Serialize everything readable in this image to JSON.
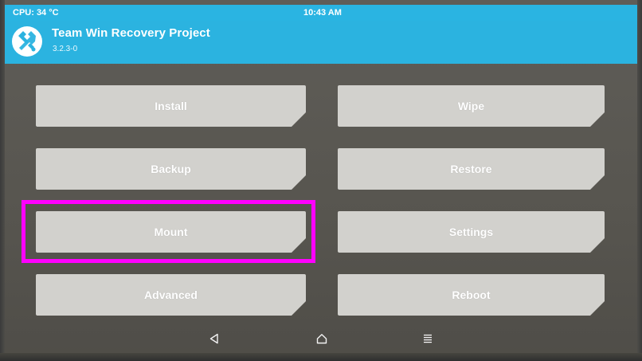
{
  "status_bar": {
    "cpu": "CPU: 34 °C",
    "time": "10:43 AM"
  },
  "header": {
    "title": "Team Win Recovery Project",
    "version": "3.2.3-0",
    "logo_icon": "twrp-logo-icon"
  },
  "buttons": {
    "install": "Install",
    "wipe": "Wipe",
    "backup": "Backup",
    "restore": "Restore",
    "mount": "Mount",
    "settings": "Settings",
    "advanced": "Advanced",
    "reboot": "Reboot"
  },
  "nav": {
    "back_icon": "back-triangle-icon",
    "home_icon": "home-icon",
    "menu_icon": "menu-lines-icon"
  },
  "colors": {
    "accent": "#2bb3e0",
    "button_bg": "#d2d1cd",
    "background": "#5a5853",
    "highlight": "#ff00ff"
  }
}
